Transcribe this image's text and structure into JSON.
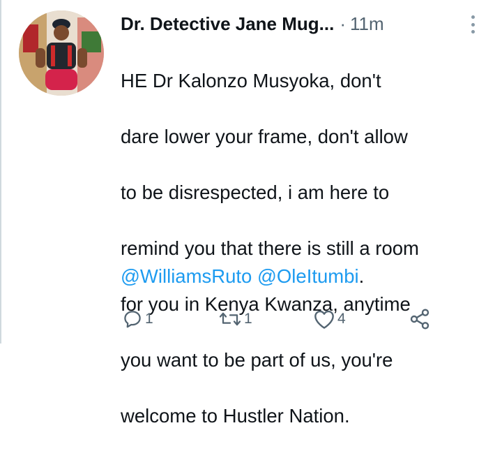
{
  "tweet": {
    "author_name": "Dr. Detective Jane Mug...",
    "separator": "·",
    "timestamp": "11m",
    "body_lines": [
      "HE Dr Kalonzo Musyoka, don't",
      "dare lower your frame, don't allow",
      "to be disrespected, i am here to",
      "remind you that there is still a room",
      "for you in Kenya Kwanza, anytime",
      "you want to be part of us, you're",
      "welcome to Hustler Nation."
    ],
    "mentions": [
      "@WilliamsRuto",
      "@OleItumbi"
    ],
    "trailing_punct": "."
  },
  "actions": {
    "reply": {
      "icon": "reply-icon",
      "count": "1"
    },
    "retweet": {
      "icon": "retweet-icon",
      "count": "1"
    },
    "like": {
      "icon": "heart-icon",
      "count": "4"
    },
    "share": {
      "icon": "share-icon"
    }
  },
  "colors": {
    "text": "#0f1419",
    "secondary": "#536471",
    "link": "#1d9bf0"
  }
}
